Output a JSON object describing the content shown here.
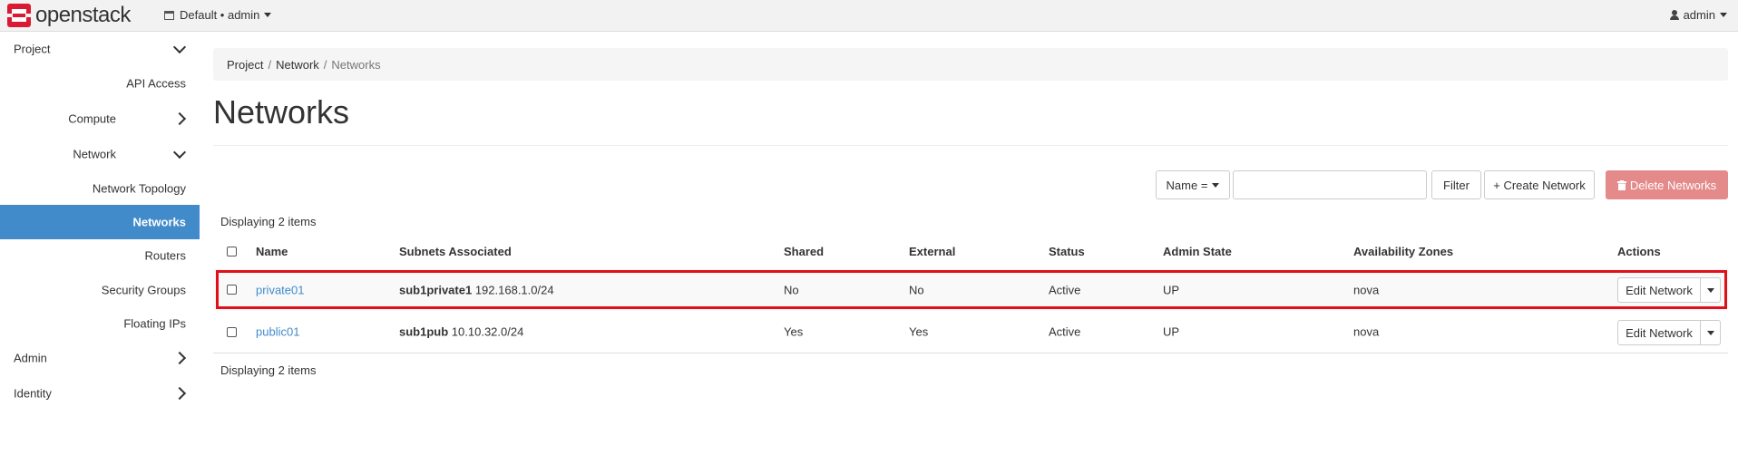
{
  "header": {
    "brand": "openstack",
    "project_selector": "Default • admin",
    "user": "admin"
  },
  "sidebar": {
    "items": [
      {
        "label": "Project"
      },
      {
        "label": "API Access"
      },
      {
        "label": "Compute"
      },
      {
        "label": "Network"
      },
      {
        "label": "Network Topology"
      },
      {
        "label": "Networks"
      },
      {
        "label": "Routers"
      },
      {
        "label": "Security Groups"
      },
      {
        "label": "Floating IPs"
      },
      {
        "label": "Admin"
      },
      {
        "label": "Identity"
      }
    ]
  },
  "breadcrumb": {
    "items": [
      "Project",
      "Network",
      "Networks"
    ],
    "separator": "/"
  },
  "page": {
    "title": "Networks"
  },
  "toolbar": {
    "filter_field": "Name =",
    "filter_input_value": "",
    "filter_button": "Filter",
    "create_button": "+ Create Network",
    "delete_button": "Delete Networks"
  },
  "table": {
    "count_top": "Displaying 2 items",
    "count_bottom": "Displaying 2 items",
    "columns": [
      "Name",
      "Subnets Associated",
      "Shared",
      "External",
      "Status",
      "Admin State",
      "Availability Zones",
      "Actions"
    ],
    "rows": [
      {
        "name": "private01",
        "subnet_name": "sub1private1",
        "subnet_cidr": "192.168.1.0/24",
        "shared": "No",
        "external": "No",
        "status": "Active",
        "admin_state": "UP",
        "zones": "nova",
        "action": "Edit Network"
      },
      {
        "name": "public01",
        "subnet_name": "sub1pub",
        "subnet_cidr": "10.10.32.0/24",
        "shared": "Yes",
        "external": "Yes",
        "status": "Active",
        "admin_state": "UP",
        "zones": "nova",
        "action": "Edit Network"
      }
    ]
  },
  "colors": {
    "accent": "#428bca",
    "highlight": "#e0101a",
    "danger": "#e48a8a",
    "logo": "#da1a32"
  }
}
